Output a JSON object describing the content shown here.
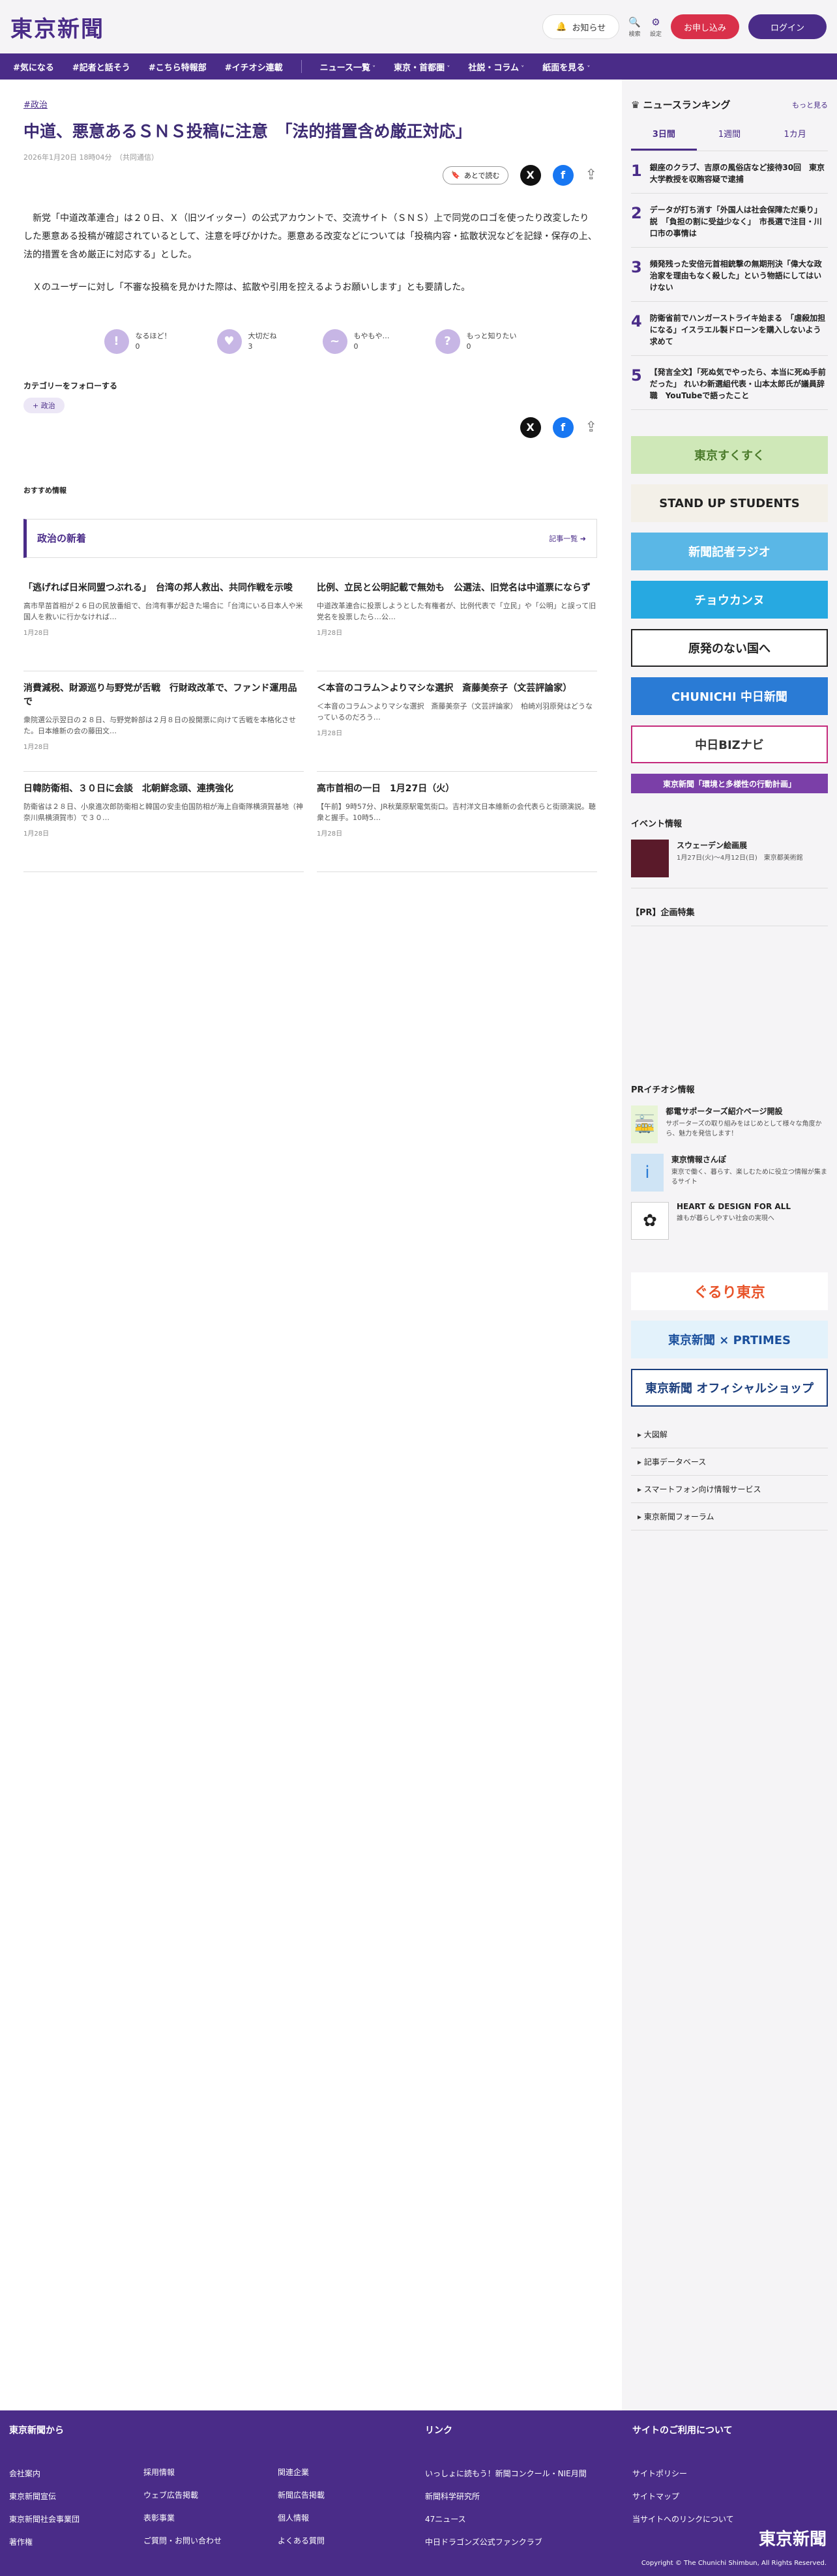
{
  "header": {
    "logo": "東京新聞",
    "notice": "お知らせ",
    "search": "検索",
    "settings": "設定",
    "subscribe": "お申し込み",
    "login": "ログイン"
  },
  "nav": [
    "#気になる",
    "#記者と話そう",
    "#こちら特報部",
    "#イチオシ連載",
    "ニュース一覧",
    "東京・首都圏",
    "社説・コラム",
    "紙面を見る"
  ],
  "article": {
    "category": "#政治",
    "title": "中道、悪意あるＳＮＳ投稿に注意　「法的措置含め厳正対応」",
    "date": "2026年1月20日 18時04分　（共同通信）",
    "read_later": "あとで読む",
    "p1": "新党「中道改革連合」は２０日、Ｘ（旧ツイッター）の公式アカウントで、交流サイト（ＳＮＳ）上で同党のロゴを使ったり改変したりした悪意ある投稿が確認されているとして、注意を呼びかけた。悪意ある改変などについては「投稿内容・拡散状況などを記録・保存の上、法的措置を含め厳正に対応する」とした。",
    "p2": "Ｘのユーザーに対し「不審な投稿を見かけた際は、拡散や引用を控えるようお願いします」とも要請した。"
  },
  "reactions": [
    {
      "label": "なるほど！",
      "count": "0",
      "glyph": "!"
    },
    {
      "label": "大切だね",
      "count": "3",
      "glyph": "♥"
    },
    {
      "label": "もやもや…",
      "count": "0",
      "glyph": "~"
    },
    {
      "label": "もっと知りたい",
      "count": "0",
      "glyph": "?"
    }
  ],
  "follow": {
    "heading": "カテゴリーをフォローする",
    "tag": "+ 政治"
  },
  "recommend": "おすすめ情報",
  "latest": {
    "title": "政治の新着",
    "more": "記事一覧",
    "cards": [
      {
        "title": "「逃げれば日米同盟つぶれる」　台湾の邦人救出、共同作戦を示唆",
        "excerpt": "高市早苗首相が２６日の民放番組で、台湾有事が起きた場合に「台湾にいる日本人や米国人を救いに行かなければ…",
        "date": "1月28日"
      },
      {
        "title": "比例、立民と公明記載で無効も　公選法、旧党名は中道票にならず",
        "excerpt": "中道改革連合に投票しようとした有権者が、比例代表で「立民」や「公明」と誤って旧党名を投票したら…公…",
        "date": "1月28日"
      },
      {
        "title": "消費減税、財源巡り与野党が舌戦　行財政改革で、ファンド運用品で",
        "excerpt": "衆院選公示翌日の２８日、与野党幹部は２月８日の投開票に向けて舌戦を本格化させた。日本維新の会の藤田文…",
        "date": "1月28日"
      },
      {
        "title": "＜本音のコラム＞よりマシな選択　斎藤美奈子（文芸評論家）",
        "excerpt": "＜本音のコラム＞よりマシな選択　斎藤美奈子（文芸評論家）　柏崎刈羽原発はどうなっているのだろう…",
        "date": "1月28日"
      },
      {
        "title": "日韓防衛相、３０日に会談　北朝鮮念頭、連携強化",
        "excerpt": "防衛省は２８日、小泉進次郎防衛相と韓国の安圭伯国防相が海上自衛隊横須賀基地（神奈川県横須賀市）で３０…",
        "date": "1月28日"
      },
      {
        "title": "高市首相の一日　1月27日（火）",
        "excerpt": "【午前】9時57分、JR秋葉原駅電気街口。吉村洋文日本維新の会代表らと街頭演説。聴衆と握手。10時5…",
        "date": "1月28日"
      }
    ]
  },
  "ranking": {
    "title": "ニュースランキング",
    "more": "もっと見る",
    "tabs": [
      "3日間",
      "1週間",
      "1カ月"
    ],
    "items": [
      {
        "n": "1",
        "text": "銀座のクラブ、吉原の風俗店など接待30回　東京大学教授を収賄容疑で逮捕"
      },
      {
        "n": "2",
        "text": "データが打ち消す「外国人は社会保障ただ乗り」説　「負担の割に受益少なく」　市長選で注目・川口市の事情は"
      },
      {
        "n": "3",
        "text": "頻発残った安倍元首相銃撃の無期刑決「偉大な政治家を理由もなく殺した」という物語にしてはいけない"
      },
      {
        "n": "4",
        "text": "防衛省前でハンガーストライキ始まる　「虐殺加担になる」イスラエル製ドローンを購入しないよう求めて"
      },
      {
        "n": "5",
        "text": "【発言全文】「死ぬ気でやったら、本当に死ぬ手前だった」 れいわ新選組代表・山本太郎氏が議員辞職　YouTubeで語ったこと"
      }
    ]
  },
  "banners": [
    "東京すくすく",
    "STAND UP STUDENTS",
    "新聞記者ラジオ",
    "チョウカンヌ",
    "原発のない国へ",
    "CHUNICHI 中日新聞",
    "中日BIZナビ",
    "東京新聞「環境と多様性の行動計画」"
  ],
  "event": {
    "heading": "イベント情報",
    "title": "スウェーデン絵画展",
    "detail": "1月27日(火)～4月12日(日)　東京都美術館"
  },
  "pr": {
    "heading": "【PR】企画特集"
  },
  "pickup": {
    "heading": "PRイチオシ情報",
    "items": [
      {
        "title": "都電サポーターズ紹介ページ開設",
        "desc": "サポーターズの取り組みをはじめとして様々な角度から、魅力を発信します！"
      },
      {
        "title": "東京情報さんぽ",
        "desc": "東京で働く、暮らす、楽しむために役立つ情報が集まるサイト"
      },
      {
        "title": "HEART & DESIGN FOR ALL",
        "desc": "誰もが暮らしやすい社会の実現へ"
      }
    ]
  },
  "side_banners": [
    "ぐるり東京",
    "東京新聞 × PRTIMES",
    "東京新聞 オフィシャルショップ"
  ],
  "side_links": [
    "大図解",
    "記事データベース",
    "スマートフォン向け情報サービス",
    "東京新聞フォーラム"
  ],
  "footer": {
    "col1_h": "東京新聞から",
    "col1": [
      "会社案内",
      "東京新聞宣伝",
      "東京新聞社会事業団",
      "著作権"
    ],
    "col2": [
      "採用情報",
      "ウェブ広告掲載",
      "表彰事業",
      "ご質問・お問い合わせ"
    ],
    "col3": [
      "関連企業",
      "新聞広告掲載",
      "個人情報",
      "よくある質問"
    ],
    "col4_h": "リンク",
    "col4": [
      "いっしょに読もう！新聞コンクール・NIE月間",
      "新聞科学研究所",
      "47ニュース",
      "中日ドラゴンズ公式ファンクラブ"
    ],
    "col5_h": "サイトのご利用について",
    "col5": [
      "サイトポリシー",
      "サイトマップ",
      "当サイトへのリンクについて"
    ],
    "logo": "東京新聞",
    "copyright": "Copyright © The Chunichi Shimbun, All Rights Reserved."
  }
}
